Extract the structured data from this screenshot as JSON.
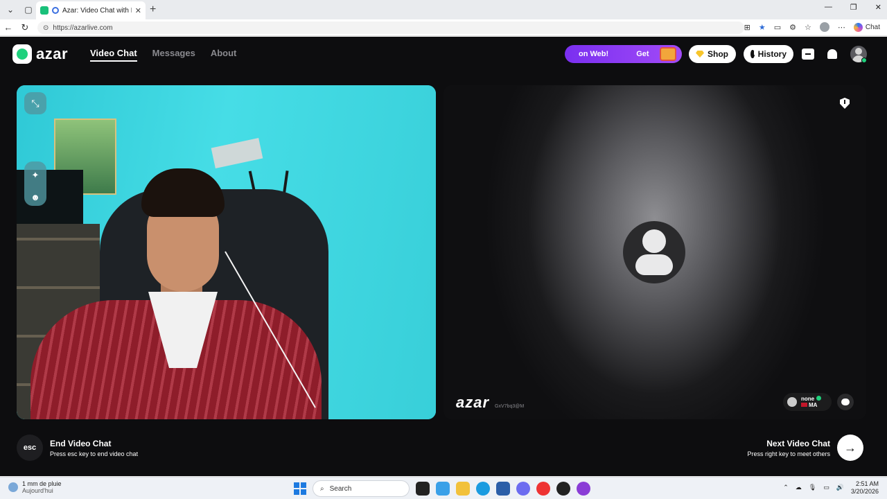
{
  "browser": {
    "tab_title": "Azar: Video Chat with New Pe",
    "url": "https://azarlive.com",
    "copilot_label": "Chat"
  },
  "nav": {
    "logo_text": "azar",
    "items": [
      "Video Chat",
      "Messages",
      "About"
    ],
    "promo_text": "on Web!",
    "promo_cta": "Get",
    "shop_label": "Shop",
    "history_label": "History"
  },
  "remote": {
    "watermark": "azar",
    "session_id": "GxV7bq3@M",
    "username": "none",
    "country": "MA"
  },
  "controls": {
    "esc_key": "esc",
    "end_title": "End Video Chat",
    "end_hint": "Press esc key to end video chat",
    "next_title": "Next Video Chat",
    "next_hint": "Press right key to meet others"
  },
  "taskbar": {
    "weather_title": "1 mm de pluie",
    "weather_sub": "Aujourd'hui",
    "search_placeholder": "Search",
    "time": "2:51 AM",
    "date": "3/20/2026"
  },
  "colors": {
    "brand_green": "#1fd17d",
    "promo_purple": "#7a2ff0",
    "page_bg": "#0d0d0f"
  }
}
